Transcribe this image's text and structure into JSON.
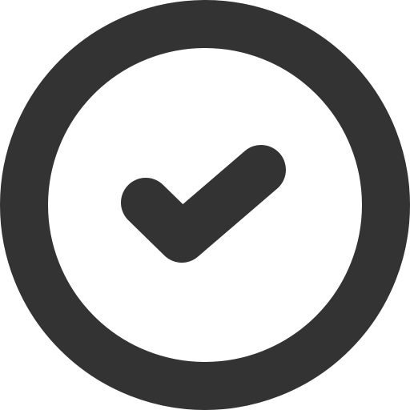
{
  "icon": {
    "name": "check-circle-icon",
    "color": "#333333",
    "background": "#ffffff"
  }
}
